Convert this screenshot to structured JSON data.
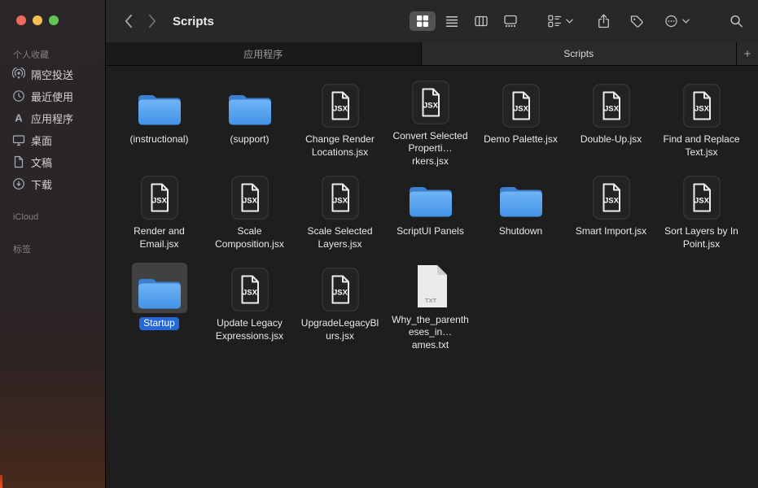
{
  "window": {
    "title": "Scripts"
  },
  "toolbar": {
    "back_icon": "chevron-left",
    "forward_icon": "chevron-right",
    "view_buttons": [
      {
        "name": "icon-view",
        "active": true
      },
      {
        "name": "list-view",
        "active": false
      },
      {
        "name": "column-view",
        "active": false
      },
      {
        "name": "gallery-view",
        "active": false
      }
    ],
    "action_icons": [
      "group-by",
      "share",
      "tag",
      "more",
      "search"
    ]
  },
  "tabbar": {
    "tabs": [
      {
        "id": "applications",
        "label": "应用程序",
        "active": false
      },
      {
        "id": "scripts",
        "label": "Scripts",
        "active": true
      }
    ],
    "new_tab_label": "+"
  },
  "sidebar": {
    "sections": [
      {
        "header": "个人收藏",
        "items": [
          {
            "id": "airdrop",
            "label": "隔空投送"
          },
          {
            "id": "recents",
            "label": "最近使用"
          },
          {
            "id": "applications",
            "label": "应用程序"
          },
          {
            "id": "desktop",
            "label": "桌面"
          },
          {
            "id": "documents",
            "label": "文稿"
          },
          {
            "id": "downloads",
            "label": "下载"
          }
        ]
      },
      {
        "header": "iCloud",
        "items": []
      },
      {
        "header": "标签",
        "items": []
      }
    ]
  },
  "file_badges": {
    "jsx": "JSX",
    "txt": "TXT"
  },
  "files": [
    {
      "name": "(instructional)",
      "type": "folder",
      "selected": false
    },
    {
      "name": "(support)",
      "type": "folder",
      "selected": false
    },
    {
      "name": "Change Render Locations.jsx",
      "type": "jsx",
      "selected": false
    },
    {
      "name": "Convert Selected Properti…rkers.jsx",
      "type": "jsx",
      "selected": false
    },
    {
      "name": "Demo Palette.jsx",
      "type": "jsx",
      "selected": false
    },
    {
      "name": "Double-Up.jsx",
      "type": "jsx",
      "selected": false
    },
    {
      "name": "Find and Replace Text.jsx",
      "type": "jsx",
      "selected": false
    },
    {
      "name": "Render and Email.jsx",
      "type": "jsx",
      "selected": false
    },
    {
      "name": "Scale Composition.jsx",
      "type": "jsx",
      "selected": false
    },
    {
      "name": "Scale Selected Layers.jsx",
      "type": "jsx",
      "selected": false
    },
    {
      "name": "ScriptUI Panels",
      "type": "folder",
      "selected": false
    },
    {
      "name": "Shutdown",
      "type": "folder",
      "selected": false
    },
    {
      "name": "Smart Import.jsx",
      "type": "jsx",
      "selected": false
    },
    {
      "name": "Sort Layers by In Point.jsx",
      "type": "jsx",
      "selected": false
    },
    {
      "name": "Startup",
      "type": "folder",
      "selected": true
    },
    {
      "name": "Update Legacy Expressions.jsx",
      "type": "jsx",
      "selected": false
    },
    {
      "name": "UpgradeLegacyBlurs.jsx",
      "type": "jsx",
      "selected": false
    },
    {
      "name": "Why_the_parentheses_in…ames.txt",
      "type": "txt",
      "selected": false
    }
  ],
  "colors": {
    "accent_blue": "#2667d9",
    "folder_blue": "#4a9bed",
    "selection_box": "#414141",
    "traffic_red": "#ec6a5e",
    "traffic_yellow": "#f4bf4f",
    "traffic_green": "#61c455"
  }
}
